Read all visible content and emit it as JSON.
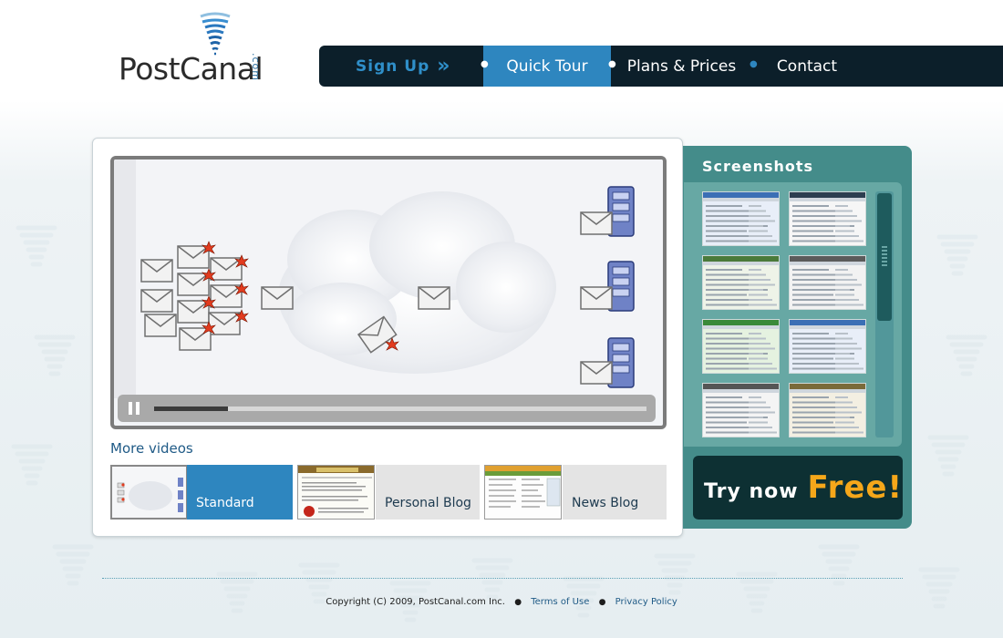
{
  "brand": {
    "name": "PostCanal",
    "suffix": ".com"
  },
  "nav": {
    "signup_label": "Sign Up",
    "signup_chevron": "»",
    "items": [
      {
        "label": "Quick Tour",
        "active": true
      },
      {
        "label": "Plans & Prices",
        "active": false
      },
      {
        "label": "Contact",
        "active": false
      }
    ],
    "separator": "●"
  },
  "video": {
    "progress": 0.15,
    "state": "playing",
    "control_icon": "pause-icon"
  },
  "more_videos": {
    "heading": "More videos",
    "items": [
      {
        "label": "Standard",
        "active": true,
        "thumb": "cloud-email-diagram"
      },
      {
        "label": "Personal Blog",
        "active": false,
        "thumb": "organic-city-blog-page"
      },
      {
        "label": "News Blog",
        "active": false,
        "thumb": "admin-table-screenshot"
      }
    ]
  },
  "screenshots": {
    "title": "Screenshots",
    "count": 8
  },
  "cta": {
    "text": "Try now",
    "highlight": "Free!"
  },
  "footer": {
    "copyright": "Copyright (C) 2009, PostCanal.com Inc.",
    "links": [
      "Terms of Use",
      "Privacy Policy"
    ]
  },
  "colors": {
    "nav_bg": "#0c1f2a",
    "accent_blue": "#2e86bf",
    "teal_panel": "#448c8a",
    "cta_orange": "#f5a71a"
  }
}
